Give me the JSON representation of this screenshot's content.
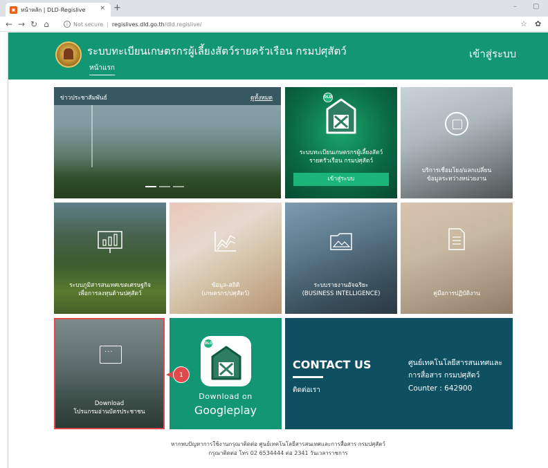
{
  "browser": {
    "tab_title": "หน้าหลัก | DLD-Regislive",
    "tab_close": "×",
    "new_tab": "+",
    "security_label": "Not secure",
    "url_host": "regislives.dld.go.th",
    "url_path": "/dld.regislive/"
  },
  "header": {
    "site_title": "ระบบทะเบียนเกษตรกรผู้เลี้ยงสัตว์รายครัวเรือน กรมปศุสัตว์",
    "nav_home": "หน้าแรก",
    "login": "เข้าสู่ระบบ"
  },
  "news": {
    "title": "ข่าวประชาสัมพันธ์",
    "view_all": "ดูทั้งหมด"
  },
  "tiles": {
    "registration": {
      "badge": "DLD",
      "line1": "ระบบทะเบียนเกษตรกรผู้เลี้ยงสัตว์",
      "line2": "รายครัวเรือน กรมปศุสัตว์",
      "button": "เข้าสู่ระบบ"
    },
    "linkage": {
      "line1": "บริการเชื่อมโยง/แลกเปลี่ยน",
      "line2": "ข้อมูลระหว่างหน่วยงาน"
    },
    "economy": {
      "line1": "ระบบภูมิสารสนเทศเขตเศรษฐกิจ",
      "line2": "เพื่อการลงทุนด้านปศุสัตว์"
    },
    "statistics": {
      "line1": "ข้อมูล-สถิติ",
      "line2": "(เกษตรกร/ปศุสัตว์)"
    },
    "bi": {
      "line1": "ระบบรายงานอัจฉริยะ",
      "line2": "(BUSINESS INTELLIGENCE)"
    },
    "manual": {
      "line1": "คู่มือการปฏิบัติงาน"
    },
    "download": {
      "line1": "Download",
      "line2": "โปรแกรมอ่านบัตรประชาชน"
    },
    "google_play": {
      "badge": "DLD",
      "line1": "Download on",
      "line2": "Googleplay"
    }
  },
  "contact": {
    "heading": "CONTACT US",
    "subheading": "ติดต่อเรา",
    "org_line1": "ศูนย์เทคโนโลยีสารสนเทศและ",
    "org_line2": "การสื่อสาร กรมปศุสัตว์",
    "counter": "Counter : 642900"
  },
  "callout": {
    "number": "1"
  },
  "footer": {
    "line1": "หากพบปัญหาการใช้งานกรุณาติดต่อ ศูนย์เทคโนโลยีสารสนเทศและการสื่อสาร กรมปศุสัตว์",
    "line2": "กรุณาติดต่อ โทร 02 6534444 ต่อ 2341 วันเวลาราชการ"
  },
  "colors": {
    "brand_green": "#129673",
    "contact_bg": "#0e4f61",
    "highlight_red": "#e0484b"
  }
}
